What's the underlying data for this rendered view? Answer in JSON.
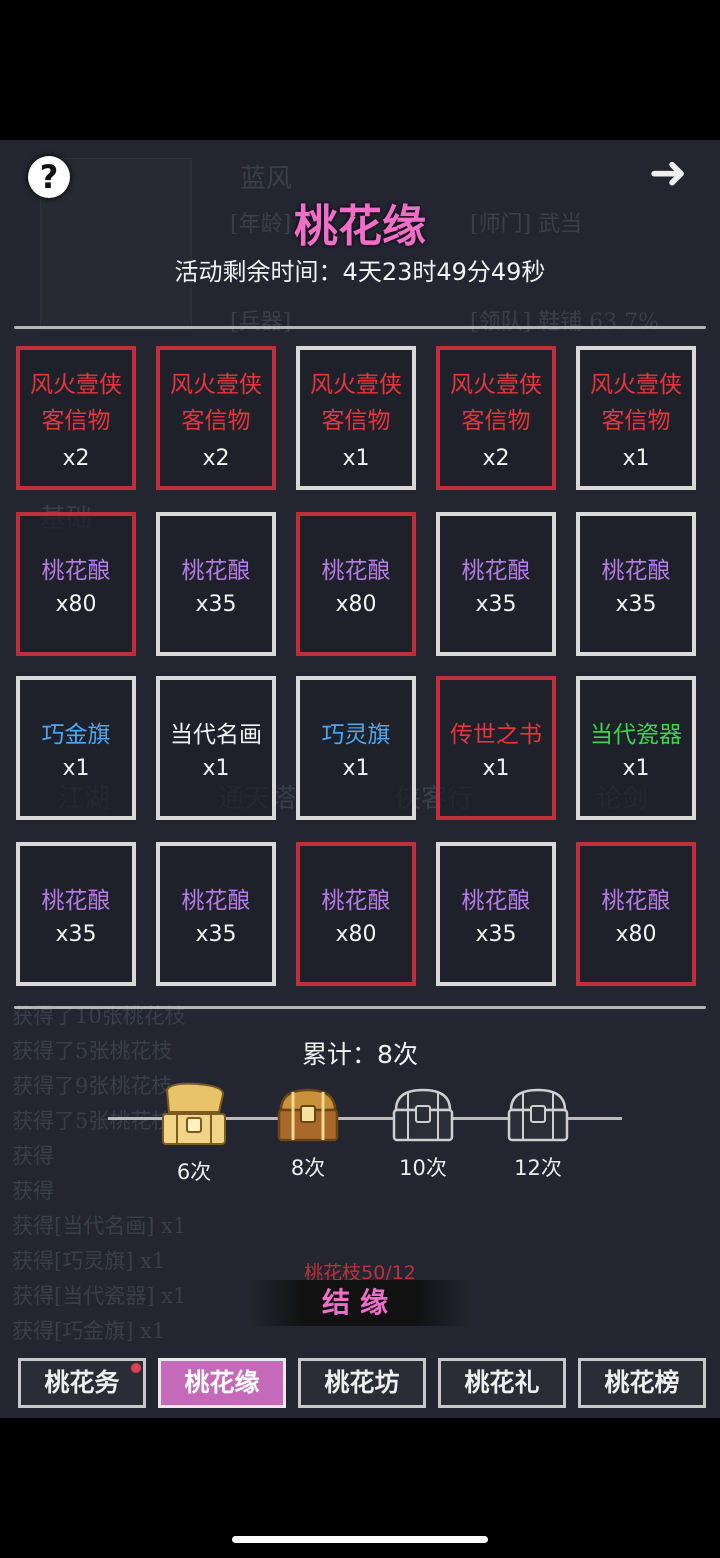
{
  "header": {
    "help_icon": "question-mark-icon",
    "back_icon": "arrow-right-icon",
    "title": "桃花缘",
    "timer_label": "活动剩余时间：",
    "timer_value": "4天23时49分49秒"
  },
  "background": {
    "char_name": "蓝风",
    "lines": [
      "[年龄]",
      "[师门] 武当",
      "[兵器]",
      "[领队] 鞋铺 63.7%",
      "基础",
      "江湖",
      "通天塔",
      "侠客行",
      "论剑"
    ],
    "log": [
      "获得了10张桃花枝",
      "获得了5张桃花枝",
      "获得了9张桃花枝",
      "获得了5张桃花枝",
      "获得",
      "获得",
      "获得[当代名画] x1",
      "获得[巧灵旗] x1",
      "获得[当代瓷器] x1",
      "获得[巧金旗] x1"
    ]
  },
  "grid": {
    "rows": [
      [
        {
          "name": "风火壹侠客信物",
          "line1": "风火壹侠",
          "line2": "客信物",
          "qty": "x2",
          "color": "#e8343c",
          "border": "red"
        },
        {
          "name": "风火壹侠客信物",
          "line1": "风火壹侠",
          "line2": "客信物",
          "qty": "x2",
          "color": "#e8343c",
          "border": "red"
        },
        {
          "name": "风火壹侠客信物",
          "line1": "风火壹侠",
          "line2": "客信物",
          "qty": "x1",
          "color": "#e8343c",
          "border": "white"
        },
        {
          "name": "风火壹侠客信物",
          "line1": "风火壹侠",
          "line2": "客信物",
          "qty": "x2",
          "color": "#e8343c",
          "border": "red"
        },
        {
          "name": "风火壹侠客信物",
          "line1": "风火壹侠",
          "line2": "客信物",
          "qty": "x1",
          "color": "#e8343c",
          "border": "white"
        }
      ],
      [
        {
          "name": "桃花酿",
          "qty": "x80",
          "color": "#b77be6",
          "border": "red"
        },
        {
          "name": "桃花酿",
          "qty": "x35",
          "color": "#b77be6",
          "border": "white"
        },
        {
          "name": "桃花酿",
          "qty": "x80",
          "color": "#b77be6",
          "border": "red"
        },
        {
          "name": "桃花酿",
          "qty": "x35",
          "color": "#b77be6",
          "border": "white"
        },
        {
          "name": "桃花酿",
          "qty": "x35",
          "color": "#b77be6",
          "border": "white"
        }
      ],
      [
        {
          "name": "巧金旗",
          "qty": "x1",
          "color": "#4fa6f0",
          "border": "white"
        },
        {
          "name": "当代名画",
          "qty": "x1",
          "color": "#f2f2f2",
          "border": "white"
        },
        {
          "name": "巧灵旗",
          "qty": "x1",
          "color": "#4fa6f0",
          "border": "white"
        },
        {
          "name": "传世之书",
          "qty": "x1",
          "color": "#e8343c",
          "border": "red"
        },
        {
          "name": "当代瓷器",
          "qty": "x1",
          "color": "#3fd34a",
          "border": "white"
        }
      ],
      [
        {
          "name": "桃花酿",
          "qty": "x35",
          "color": "#b77be6",
          "border": "white"
        },
        {
          "name": "桃花酿",
          "qty": "x35",
          "color": "#b77be6",
          "border": "white"
        },
        {
          "name": "桃花酿",
          "qty": "x80",
          "color": "#b77be6",
          "border": "red"
        },
        {
          "name": "桃花酿",
          "qty": "x35",
          "color": "#b77be6",
          "border": "white"
        },
        {
          "name": "桃花酿",
          "qty": "x80",
          "color": "#b77be6",
          "border": "red"
        }
      ]
    ]
  },
  "progress": {
    "counter_label": "累计：",
    "counter_value": "8次",
    "milestones": [
      {
        "label": "6次",
        "state": "opened"
      },
      {
        "label": "8次",
        "state": "available"
      },
      {
        "label": "10次",
        "state": "locked"
      },
      {
        "label": "12次",
        "state": "locked"
      }
    ]
  },
  "action": {
    "branch_count": "桃花枝50/12",
    "bond_button": "结缘"
  },
  "tabs": [
    {
      "label": "桃花务",
      "active": false,
      "badge": true
    },
    {
      "label": "桃花缘",
      "active": true,
      "badge": false
    },
    {
      "label": "桃花坊",
      "active": false,
      "badge": false
    },
    {
      "label": "桃花礼",
      "active": false,
      "badge": false
    },
    {
      "label": "桃花榜",
      "active": false,
      "badge": false
    }
  ],
  "colors": {
    "accent_pink": "#f06ec8",
    "border_red": "#c0303a",
    "border_white": "#d9d9d9",
    "panel_bg": "#232630"
  }
}
